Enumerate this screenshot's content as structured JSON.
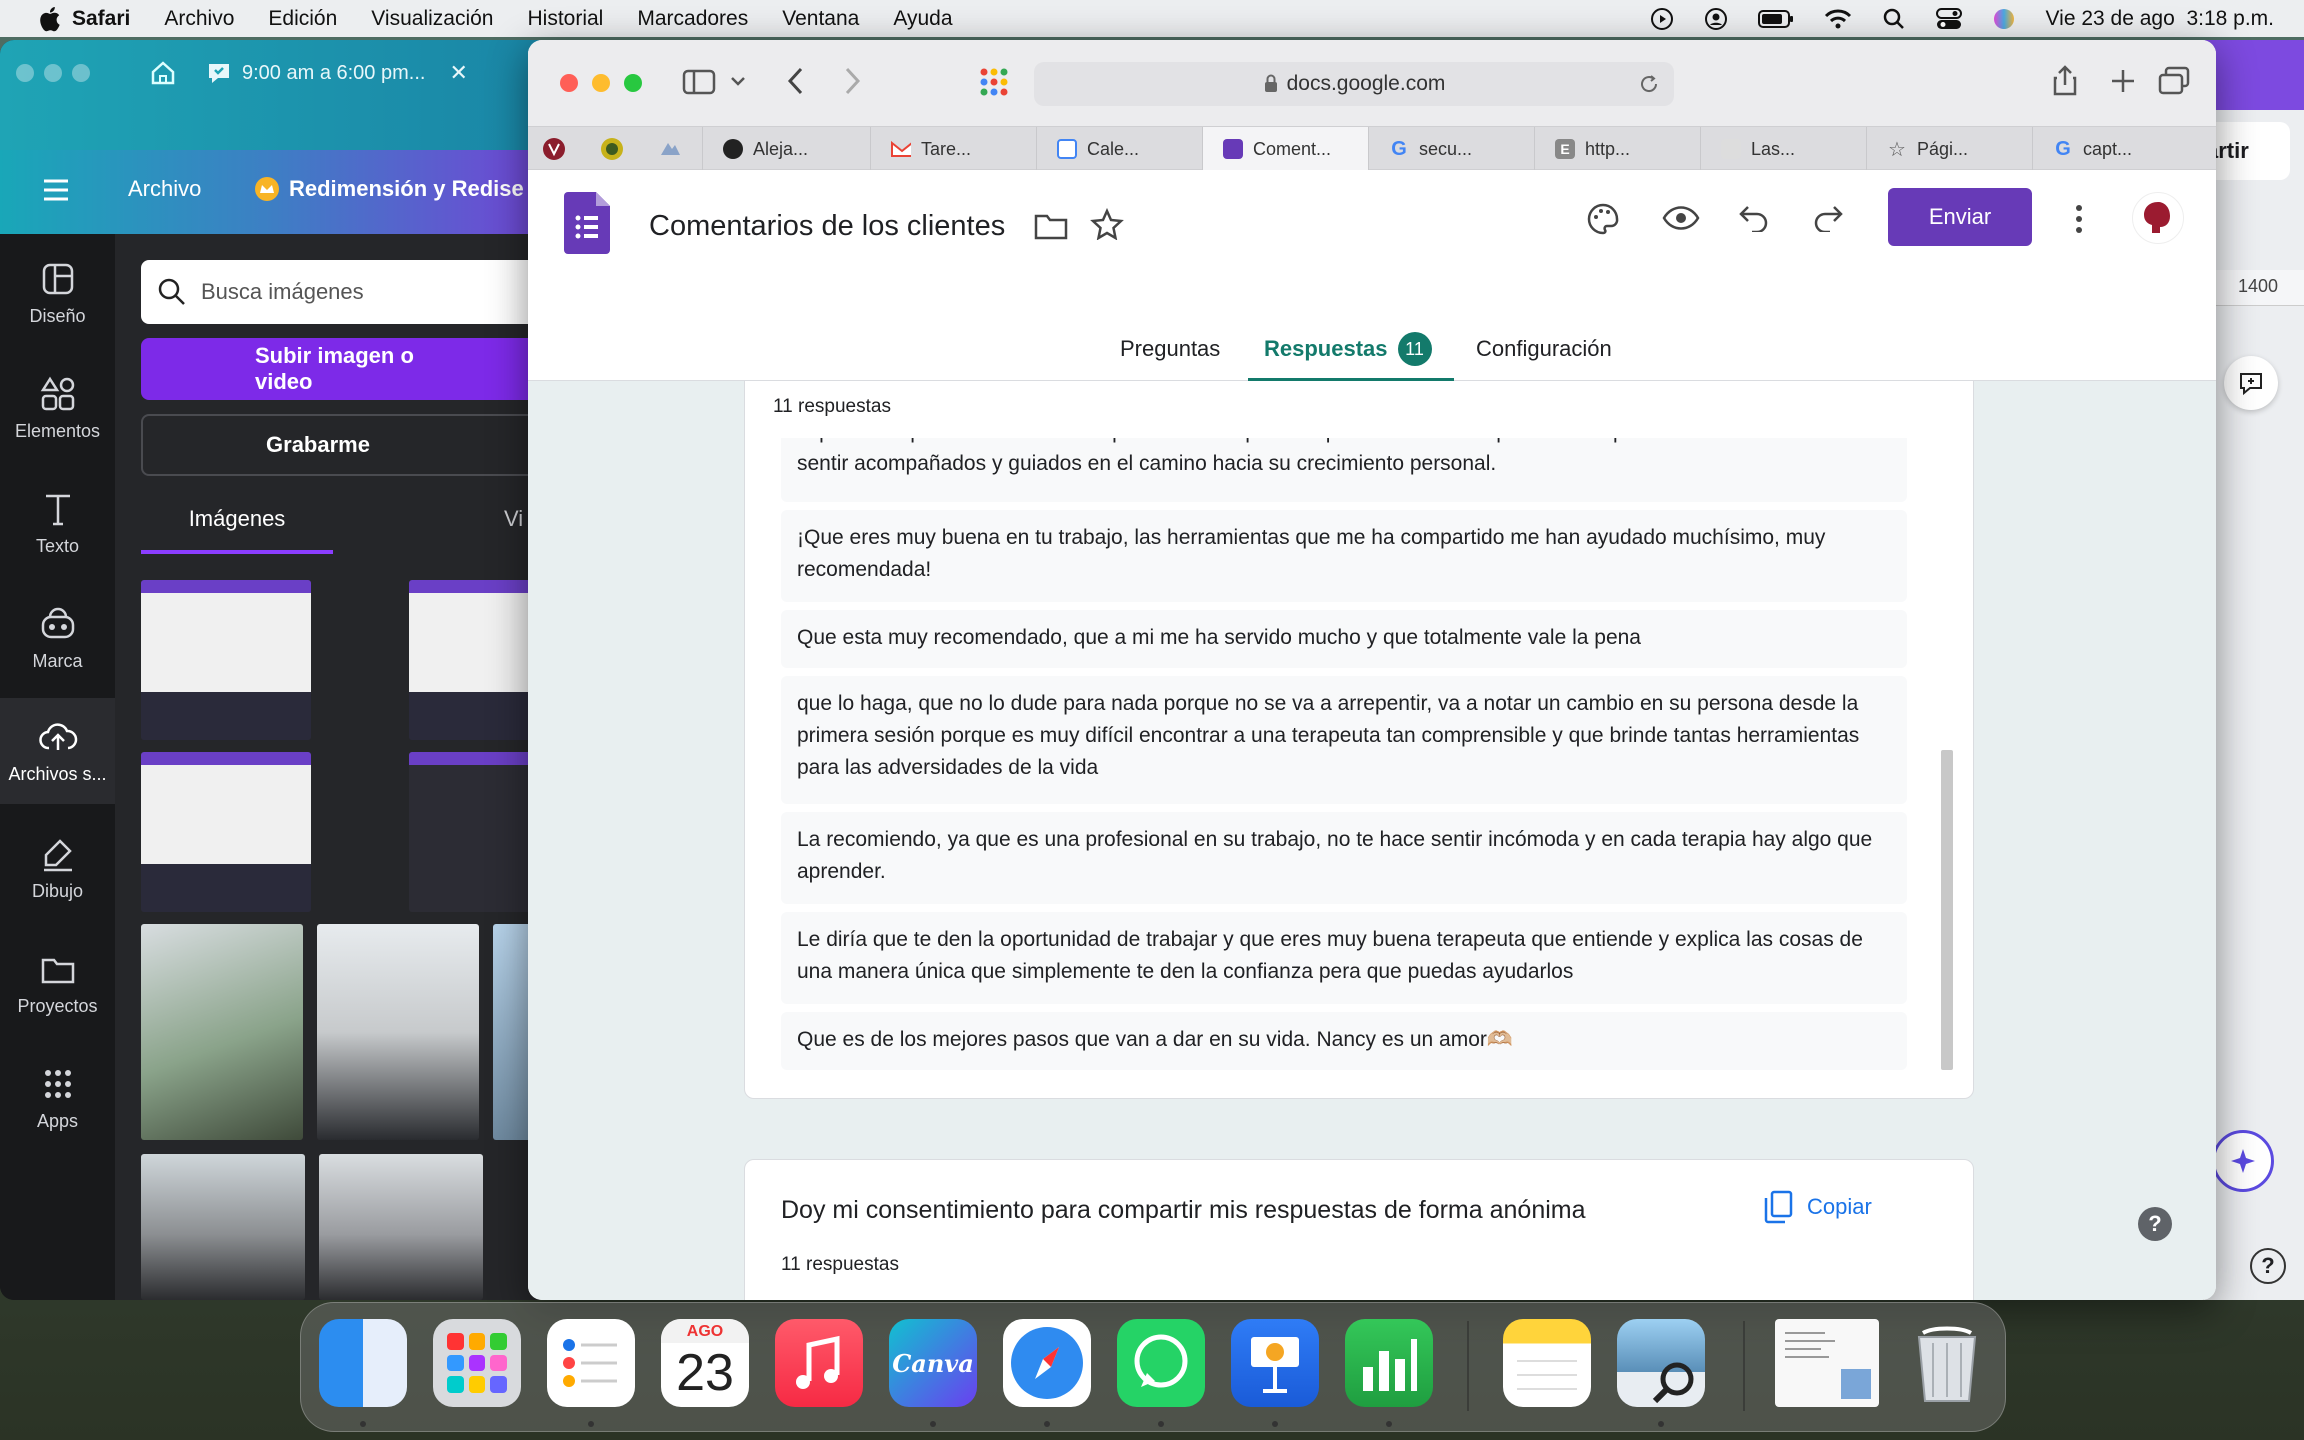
{
  "menubar": {
    "items": [
      "Safari",
      "Archivo",
      "Edición",
      "Visualización",
      "Historial",
      "Marcadores",
      "Ventana",
      "Ayuda"
    ],
    "datetime": "Vie 23 de ago  3:18 p.m."
  },
  "canva": {
    "tab_title": "9:00 am a 6:00 pm...",
    "header_menu": "Archivo",
    "header_title": "Redimensión y Redise",
    "header_share_fragment": "artir",
    "rail": [
      "Diseño",
      "Elementos",
      "Texto",
      "Marca",
      "Archivos s...",
      "Dibujo",
      "Proyectos",
      "Apps"
    ],
    "search_placeholder": "Busca imágenes",
    "upload_button": "Subir imagen o video",
    "record_button": "Grabarme",
    "tab_images": "Imágenes",
    "tab_video_fragment": "Vi",
    "ruler_value": "1400"
  },
  "safari": {
    "url": "docs.google.com",
    "tabs": [
      "Aleja...",
      "Tare...",
      "Cale...",
      "Coment...",
      "secu...",
      "http...",
      "Las...",
      "Pági...",
      "capt..."
    ]
  },
  "form": {
    "title": "Comentarios de los clientes",
    "send_button": "Enviar",
    "tabs": {
      "questions": "Preguntas",
      "responses": "Respuestas",
      "responses_count": "11",
      "settings": "Configuración"
    },
    "q1_count": "11 respuestas",
    "partial_response_line1": "experiencia para contactar con la problemática que sea quieran llevar a su proceso terapéutico. Se van a",
    "partial_response_line2": "sentir acompañados y guiados en el camino hacia su crecimiento personal.",
    "responses": [
      "¡Que eres muy buena en tu trabajo, las herramientas que me ha compartido me han ayudado muchísimo, muy recomendada!",
      "Que esta muy recomendado, que a mi me ha servido mucho y que totalmente vale la pena",
      "que lo haga, que no lo dude para nada porque no se va a arrepentir, va a notar un cambio en su persona desde la primera sesión porque es muy difícil encontrar a una terapeuta tan comprensible y que brinde tantas herramientas para las adversidades de la vida",
      "La recomiendo, ya que es una profesional en su trabajo, no te hace sentir incómoda y en cada terapia hay algo que aprender.",
      "Le diría que te den la oportunidad de trabajar y que eres muy buena terapeuta que entiende y explica las cosas de una manera única que simplemente te den la confianza pera que puedas ayudarlos",
      "Que es de los mejores pasos que van a dar en su vida. Nancy es un amor🫶🏼"
    ],
    "q2_title": "Doy mi consentimiento para compartir mis respuestas de forma anónima",
    "q2_count": "11 respuestas",
    "copy_button": "Copiar"
  },
  "dock": {
    "calendar_month": "AGO",
    "calendar_day": "23",
    "canva_label": "Canva"
  },
  "colors": {
    "forms_purple": "#673ab7",
    "forms_teal": "#137333",
    "canva_purple": "#7d2ae8"
  }
}
